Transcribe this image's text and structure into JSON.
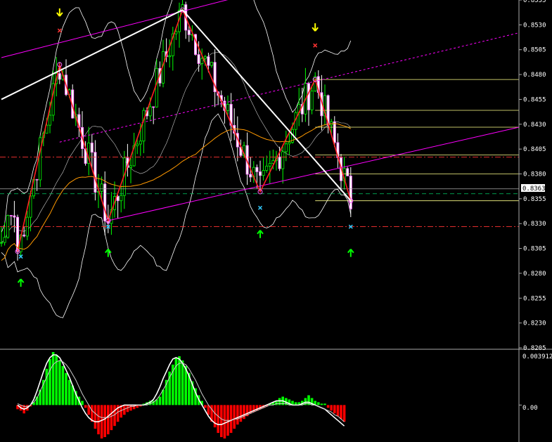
{
  "chart_data": {
    "type": "candlestick",
    "title": "",
    "ylim": [
      0.8205,
      0.8555
    ],
    "y_ticks": [
      "0.8205",
      "0.8230",
      "0.8255",
      "0.8280",
      "0.8305",
      "0.8330",
      "0.8355",
      "0.8380",
      "0.8405",
      "0.8430",
      "0.8455",
      "0.8480",
      "0.8505",
      "0.8530",
      "0.8555"
    ],
    "current_price_label": "0.8363",
    "current_price": 0.8363,
    "grid": false,
    "colors": {
      "background": "#000000",
      "bull_candle": "#00ff00",
      "bear_candle": "#ffffff",
      "zigzag": "#ff2020",
      "trend": "#ffffff",
      "channel": "#ff00ff",
      "bands": "#ffffff",
      "ma": "#ff9900",
      "fib_levels": "#ffff88",
      "arrow_up": "#00ff00",
      "arrow_down": "#ffff00",
      "hist_pos": "#00ff00",
      "hist_neg": "#ff0000"
    },
    "zigzag_points": [
      {
        "bar": 0,
        "price": 0.8302
      },
      {
        "bar": 13,
        "price": 0.849
      },
      {
        "bar": 28,
        "price": 0.8333
      },
      {
        "bar": 51,
        "price": 0.8545
      },
      {
        "bar": 75,
        "price": 0.8362
      },
      {
        "bar": 92,
        "price": 0.8475
      },
      {
        "bar": 103,
        "price": 0.8353
      }
    ],
    "trend_lines": [
      {
        "from": {
          "bar": -5,
          "price": 0.8455
        },
        "to": {
          "bar": 51,
          "price": 0.8545
        }
      },
      {
        "from": {
          "bar": 51,
          "price": 0.8545
        },
        "to": {
          "bar": 103,
          "price": 0.8353
        }
      },
      {
        "from": {
          "bar": 13,
          "price": 0.849
        },
        "to": {
          "bar": 28,
          "price": 0.8333
        }
      }
    ],
    "channel_lines": [
      {
        "from": {
          "bar": -5,
          "price": 0.8497
        },
        "to": {
          "bar": 67,
          "price": 0.8557
        },
        "style": "solid"
      },
      {
        "from": {
          "bar": 13,
          "price": 0.8412
        },
        "to": {
          "bar": 155,
          "price": 0.8522
        },
        "style": "dashed"
      },
      {
        "from": {
          "bar": 28,
          "price": 0.8333
        },
        "to": {
          "bar": 155,
          "price": 0.8427
        },
        "style": "solid"
      }
    ],
    "fib_levels": [
      0.8475,
      0.8444,
      0.8427,
      0.8399,
      0.838,
      0.8353
    ],
    "fib_start_bar": 92,
    "horizontal_levels": [
      {
        "price": 0.8397,
        "color": "#ff3333",
        "style": "dashdot"
      },
      {
        "price": 0.8327,
        "color": "#ff3333",
        "style": "dashdot"
      },
      {
        "price": 0.836,
        "color": "#00cc66",
        "style": "dashed"
      },
      {
        "price": 0.8365,
        "color": "#aaaaaa",
        "style": "solid"
      }
    ],
    "signals": [
      {
        "type": "up_arrow",
        "bar": 1,
        "price": 0.827
      },
      {
        "type": "up_arrow",
        "bar": 28,
        "price": 0.83
      },
      {
        "type": "up_arrow",
        "bar": 75,
        "price": 0.8319
      },
      {
        "type": "up_arrow",
        "bar": 103,
        "price": 0.83
      },
      {
        "type": "down_arrow",
        "bar": 13,
        "price": 0.8543
      },
      {
        "type": "down_arrow",
        "bar": 92,
        "price": 0.8528
      }
    ],
    "oscillator": {
      "zero_label": "0.00",
      "top_label": "0.003912",
      "range": [
        -0.0025,
        0.0039
      ],
      "histogram": [
        -0.0003,
        -0.0004,
        -0.0006,
        -0.0004,
        -0.0001,
        0.0002,
        0.0006,
        0.0011,
        0.0018,
        0.0026,
        0.0033,
        0.0038,
        0.0036,
        0.0032,
        0.0028,
        0.0023,
        0.0018,
        0.0014,
        0.001,
        0.0006,
        0.0003,
        -0.0002,
        -0.0007,
        -0.0012,
        -0.0017,
        -0.0021,
        -0.0024,
        -0.0023,
        -0.0021,
        -0.0018,
        -0.0015,
        -0.0012,
        -0.0009,
        -0.0007,
        -0.0005,
        -0.0004,
        -0.0003,
        -0.0002,
        -0.0001,
        0.0001,
        0.0002,
        0.0003,
        0.0003,
        0.0004,
        0.0006,
        0.0011,
        0.0018,
        0.0024,
        0.0029,
        0.0034,
        0.0035,
        0.0032,
        0.0028,
        0.0023,
        0.0017,
        0.0012,
        0.0007,
        0.0003,
        -0.0002,
        -0.0007,
        -0.0012,
        -0.0016,
        -0.002,
        -0.0023,
        -0.0024,
        -0.0022,
        -0.002,
        -0.0017,
        -0.0014,
        -0.0012,
        -0.001,
        -0.0008,
        -0.0006,
        -0.0005,
        -0.0004,
        -0.0003,
        -0.0002,
        -0.0001,
        0.0001,
        0.0002,
        0.0003,
        0.0005,
        0.0006,
        0.0005,
        0.0004,
        0.0003,
        0.0002,
        0.0002,
        0.0003,
        0.0005,
        0.0007,
        0.0005,
        0.0003,
        0.0002,
        0.0001,
        0.0001,
        -0.0002,
        -0.0004,
        -0.0006,
        -0.0008,
        -0.001,
        -0.0012
      ],
      "line1": [
        0.0,
        -0.0002,
        -0.0003,
        -0.0002,
        0.0,
        0.0004,
        0.001,
        0.0017,
        0.0024,
        0.003,
        0.0034,
        0.0036,
        0.0036,
        0.0034,
        0.003,
        0.0025,
        0.002,
        0.0014,
        0.0008,
        0.0003,
        -0.0002,
        -0.0006,
        -0.0009,
        -0.0011,
        -0.0012,
        -0.0012,
        -0.0011,
        -0.001,
        -0.0008,
        -0.0006,
        -0.0004,
        -0.0002,
        -0.0001,
        0.0,
        0.0,
        0.0,
        0.0,
        0.0,
        0.0,
        0.0,
        0.0001,
        0.0002,
        0.0004,
        0.0008,
        0.0013,
        0.0019,
        0.0024,
        0.0029,
        0.0033,
        0.0034,
        0.0033,
        0.003,
        0.0026,
        0.0021,
        0.0015,
        0.0009,
        0.0004,
        0.0,
        -0.0004,
        -0.0008,
        -0.0011,
        -0.0013,
        -0.0014,
        -0.0014,
        -0.0013,
        -0.0012,
        -0.0011,
        -0.001,
        -0.0009,
        -0.0008,
        -0.0007,
        -0.0006,
        -0.0005,
        -0.0004,
        -0.0003,
        -0.0002,
        -0.0001,
        0.0,
        0.0001,
        0.0002,
        0.0003,
        0.0003,
        0.0003,
        0.0002,
        0.0001,
        0.0,
        0.0,
        0.0,
        0.0001,
        0.0002,
        0.0002,
        0.0001,
        0.0,
        -0.0001,
        -0.0002,
        -0.0003,
        -0.0005,
        -0.0007,
        -0.0009,
        -0.0011,
        -0.0013,
        -0.0015
      ],
      "line2": [
        0.0001,
        0.0,
        -0.0001,
        -0.0001,
        0.0,
        0.0002,
        0.0005,
        0.001,
        0.0015,
        0.002,
        0.0025,
        0.0029,
        0.0031,
        0.0032,
        0.0031,
        0.0029,
        0.0026,
        0.0022,
        0.0018,
        0.0013,
        0.0008,
        0.0004,
        0.0,
        -0.0004,
        -0.0006,
        -0.0008,
        -0.0009,
        -0.0009,
        -0.0009,
        -0.0008,
        -0.0007,
        -0.0005,
        -0.0004,
        -0.0003,
        -0.0002,
        -0.0001,
        -0.0001,
        0.0,
        0.0,
        0.0,
        0.0,
        0.0001,
        0.0002,
        0.0004,
        0.0007,
        0.0011,
        0.0015,
        0.002,
        0.0024,
        0.0028,
        0.003,
        0.003,
        0.0029,
        0.0026,
        0.0022,
        0.0018,
        0.0013,
        0.0008,
        0.0004,
        0.0,
        -0.0003,
        -0.0006,
        -0.0008,
        -0.001,
        -0.0011,
        -0.0011,
        -0.0011,
        -0.001,
        -0.001,
        -0.0009,
        -0.0008,
        -0.0007,
        -0.0006,
        -0.0005,
        -0.0004,
        -0.0003,
        -0.0002,
        -0.0001,
        0.0,
        0.0,
        0.0001,
        0.0001,
        0.0001,
        0.0001,
        0.0,
        0.0,
        0.0,
        0.0,
        0.0,
        0.0001,
        0.0001,
        0.0,
        0.0,
        -0.0001,
        -0.0002,
        -0.0003,
        -0.0004,
        -0.0005,
        -0.0007,
        -0.0008,
        -0.001,
        -0.0012
      ]
    },
    "candles_gen": {
      "note_bars": 104
    }
  }
}
